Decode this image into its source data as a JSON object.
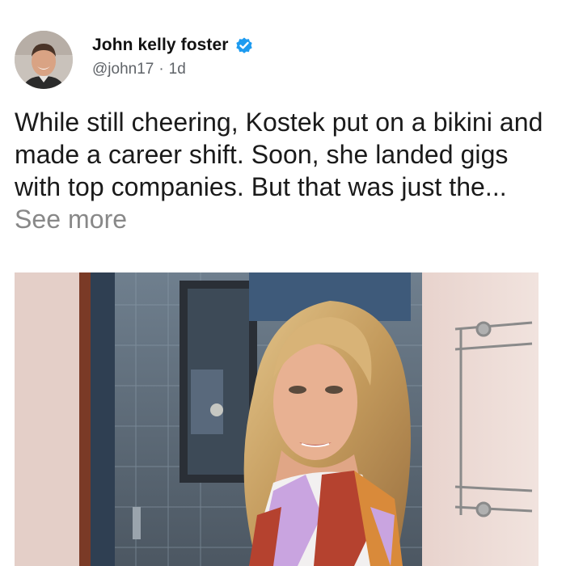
{
  "post": {
    "author": {
      "display_name": "John kelly foster",
      "handle": "@john17",
      "separator": "·",
      "timestamp": "1d",
      "verified": true,
      "verified_icon": "verified-badge-icon",
      "verified_color": "#1d9bf0"
    },
    "body": {
      "text": "While still cheering, Kostek put on a bikini and made a career shift. Soon, she landed gigs with top companies. But that was just the...",
      "see_more_label": "See more"
    },
    "media": {
      "type": "photo"
    }
  }
}
